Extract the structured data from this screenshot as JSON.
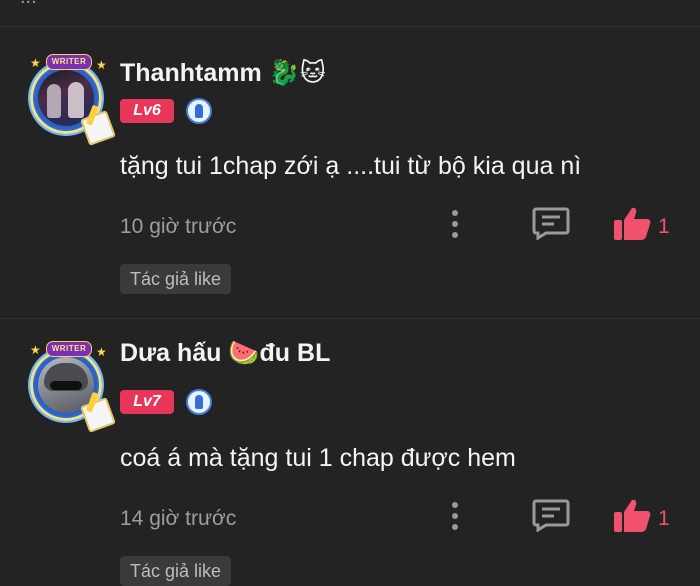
{
  "top_text": "...",
  "comments": [
    {
      "frame_label": "WRITER",
      "username": "Thanhtamm 🐉🐱",
      "level": "Lv6",
      "text": "tặng tui 1chap zới ạ ....tui từ bộ kia qua nì",
      "time": "10 giờ trước",
      "likes": "1",
      "author_like": "Tác giả like"
    },
    {
      "frame_label": "WRITER",
      "username": "Dưa hấu 🍉đu BL",
      "level": "Lv7",
      "text": "coá á mà tặng tui 1 chap được hem",
      "time": "14 giờ trước",
      "likes": "1",
      "author_like": "Tác giả like"
    }
  ],
  "colors": {
    "background": "#232323",
    "level_badge": "#e8355a",
    "like": "#f0516d",
    "muted": "#9d9d9d"
  },
  "icons": [
    "more-vertical-icon",
    "reply-icon",
    "thumbs-up-icon",
    "medal-icon"
  ]
}
